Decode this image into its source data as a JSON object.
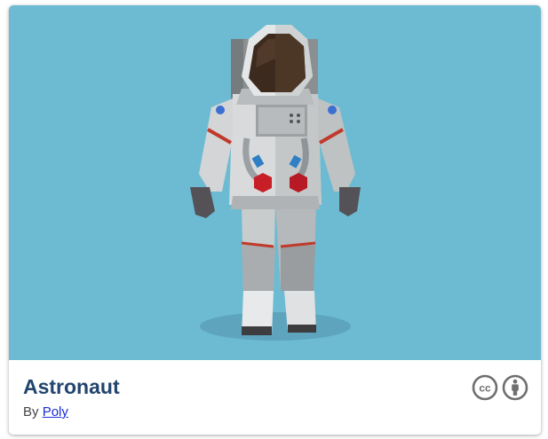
{
  "card": {
    "title": "Astronaut",
    "by_prefix": "By",
    "author": "Poly",
    "license_icons": [
      "creative-commons-icon",
      "attribution-icon"
    ],
    "license_cc_text": "cc"
  },
  "colors": {
    "preview_background": "#6cbbd3",
    "title": "#22446e",
    "link": "#1a2cd6"
  }
}
